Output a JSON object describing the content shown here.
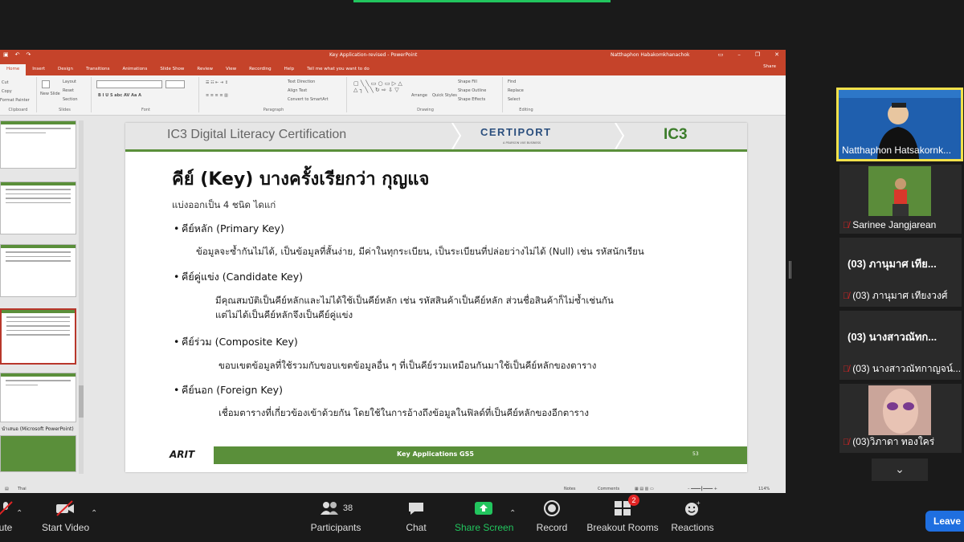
{
  "powerpoint": {
    "title": "Key Application-revised - PowerPoint",
    "user": "Natthaphon Habakomkhanachok",
    "tabs": [
      "Home",
      "Insert",
      "Design",
      "Transitions",
      "Animations",
      "Slide Show",
      "Review",
      "View",
      "Recording",
      "Help",
      "Tell me what you want to do"
    ],
    "share": "Share",
    "ribbon": {
      "clipboard": "Clipboard",
      "cut": "Cut",
      "copy": "Copy",
      "format_painter": "Format Painter",
      "new_slide": "New Slide",
      "layout": "Layout",
      "reset": "Reset",
      "section": "Section",
      "slides": "Slides",
      "font": "Font",
      "paragraph": "Paragraph",
      "text_direction": "Text Direction",
      "align_text": "Align Text",
      "convert_smartart": "Convert to SmartArt",
      "drawing": "Drawing",
      "arrange": "Arrange",
      "quick_styles": "Quick Styles",
      "shape_fill": "Shape Fill",
      "shape_outline": "Shape Outline",
      "shape_effects": "Shape Effects",
      "find": "Find",
      "replace": "Replace",
      "select": "Select",
      "editing": "Editing"
    },
    "thumb_label": "นำเสนอ (Microsoft PowerPoint)",
    "status": {
      "lang": "Thai",
      "notes": "Notes",
      "comments": "Comments",
      "zoom": "114%"
    }
  },
  "slide": {
    "header_title": "IC3 Digital Literacy Certification",
    "certiport": "CERTIPORT",
    "certiport_sub": "A PEARSON VUE BUSINESS",
    "ic3": "IC3",
    "heading": "คีย์ (Key) บางครั้งเรียกว่า กุญแจ",
    "subheading": "แบ่งออกเป็น 4 ชนิด ไดแก่",
    "items": [
      {
        "title": "คีย์หลัก (Primary Key)",
        "desc": "ข้อมูลจะซ้ำกันไม่ได้, เป็นข้อมูลที่สั้นง่าย, มีค่าในทุกระเบียน, เป็นระเบียนที่ปล่อยว่างไม่ได้ (Null) เช่น รหัสนักเรียน"
      },
      {
        "title": "คีย์คู่แข่ง (Candidate Key)",
        "desc": "มีคุณสมบัติเป็นคีย์หลักและไม่ได้ใช้เป็นคีย์หลัก เช่น รหัสสินค้าเป็นคีย์หลัก ส่วนชื่อสินค้าก็ไม่ซ้ำเช่นกัน",
        "desc2": "แต่ไม่ได้เป็นคีย์หลักจึงเป็นคีย์คู่แข่ง"
      },
      {
        "title": "คีย์ร่วม (Composite Key)",
        "desc": "ขอบเขตข้อมูลที่ใช้รวมกับขอบเขตข้อมูลอื่น ๆ ที่เป็นคีย์รวมเหมือนกันมาใช้เป็นคีย์หลักของตาราง"
      },
      {
        "title": "คีย์นอก (Foreign Key)",
        "desc": "เชื่อมตารางที่เกี่ยวข้องเข้าด้วยกัน โดยใช้ในการอ้างถึงข้อมูลในฟิลด์ที่เป็นคีย์หลักของอีกตาราง"
      }
    ],
    "footer_logo": "ARIT",
    "footer_title": "Key Applications GS5",
    "page_number": "53"
  },
  "participants": [
    {
      "name": "Natthaphon Hatsakornk...",
      "active": true
    },
    {
      "name": "Sarinee Jangjarean",
      "muted": true
    },
    {
      "big": "(03) ภานุมาศ เทีย...",
      "name": "(03) ภานุมาศ เทียงวงศ์",
      "muted": true
    },
    {
      "big": "(03) นางสาวณัทก...",
      "name": "(03) นางสาวณัทกาญจน์...",
      "muted": true
    },
    {
      "name": "(03)วิภาดา ทองใคร่",
      "muted": true
    }
  ],
  "toolbar": {
    "unmute": "ute",
    "start_video": "Start Video",
    "participants": "Participants",
    "participants_count": "38",
    "chat": "Chat",
    "share_screen": "Share Screen",
    "record": "Record",
    "breakout_rooms": "Breakout Rooms",
    "breakout_badge": "2",
    "reactions": "Reactions",
    "leave": "Leave"
  },
  "colors": {
    "ppt_accent": "#c5432a",
    "slide_green": "#5a8f3a",
    "zoom_green": "#22c55e",
    "leave_blue": "#1f6fe0",
    "active_speaker": "#f2e14a"
  }
}
